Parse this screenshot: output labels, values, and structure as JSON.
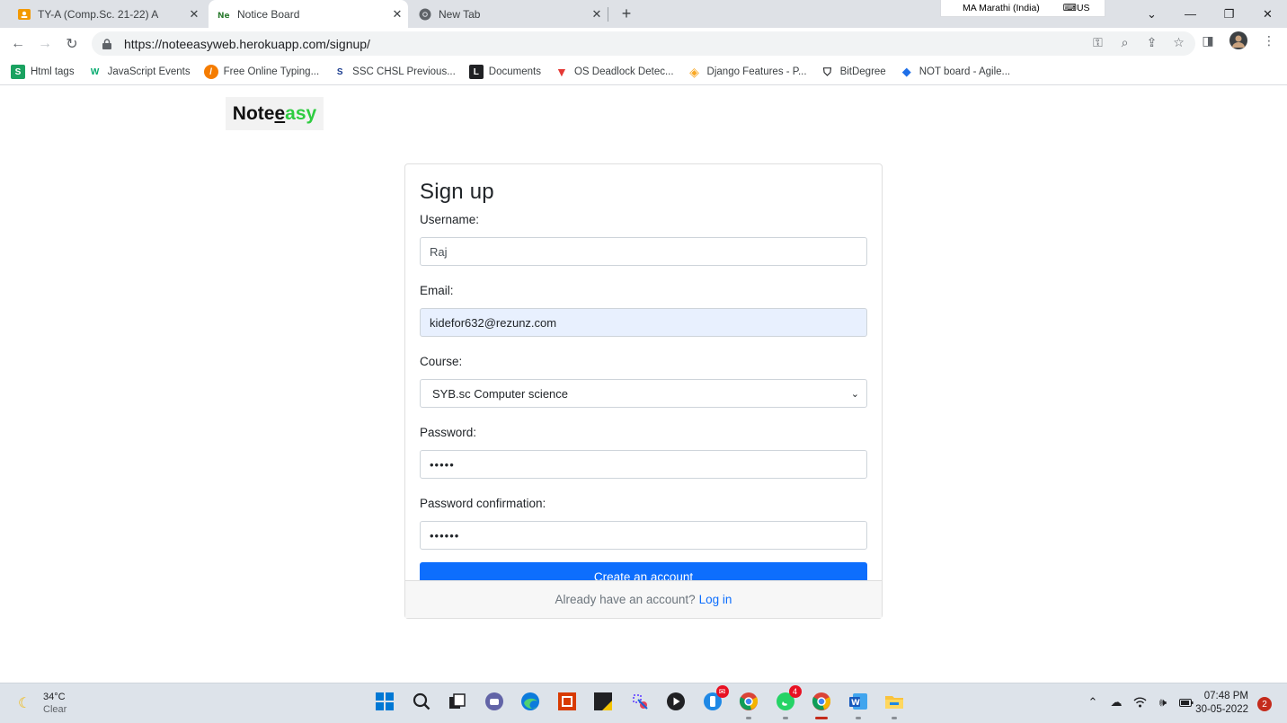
{
  "browser": {
    "tabs": [
      {
        "title": "TY-A (Comp.Sc. 21-22) A",
        "icon": "classroom-icon",
        "active": false
      },
      {
        "title": "Notice Board",
        "icon": "noteasy-icon",
        "active": true
      },
      {
        "title": "New Tab",
        "icon": "chrome-icon",
        "active": false
      }
    ],
    "ime_language": "MA Marathi (India)",
    "ime_layout": "US",
    "url": "https://noteeasyweb.herokuapp.com/signup/",
    "bookmarks": [
      {
        "label": "Html tags",
        "icon": "s-icon",
        "color": "#1aa260"
      },
      {
        "label": "JavaScript Events",
        "icon": "w3-icon",
        "color": "#04aa6d"
      },
      {
        "label": "Free Online Typing...",
        "icon": "typing-icon",
        "color": "#f57c00"
      },
      {
        "label": "SSC CHSL Previous...",
        "icon": "ss-icon",
        "color": "#1a3c8f"
      },
      {
        "label": "Documents",
        "icon": "documents-icon",
        "color": "#202124"
      },
      {
        "label": "OS Deadlock Detec...",
        "icon": "deadlock-icon",
        "color": "#e53935"
      },
      {
        "label": "Django Features - P...",
        "icon": "django-icon",
        "color": "#f9a825"
      },
      {
        "label": "BitDegree",
        "icon": "bitdegree-icon",
        "color": "#202124"
      },
      {
        "label": "NOT board - Agile...",
        "icon": "agile-icon",
        "color": "#1e6fe8"
      }
    ]
  },
  "page": {
    "logo": {
      "part1": "Note",
      "part2": "asy",
      "underlined": "e"
    },
    "form": {
      "title": "Sign up",
      "username_label": "Username:",
      "username_value": "Raj",
      "email_label": "Email:",
      "email_value": "kidefor632@rezunz.com",
      "course_label": "Course:",
      "course_value": "SYB.sc Computer science",
      "password_label": "Password:",
      "password_value": "•••••",
      "password_confirm_label": "Password confirmation:",
      "password_confirm_value": "••••••",
      "submit_label": "Create an account",
      "footer_text": "Already have an account?",
      "login_link": "Log in"
    },
    "accent_color": "#0d6efd"
  },
  "taskbar": {
    "weather_temp": "34°C",
    "weather_condition": "Clear",
    "whatsapp_badge": "4",
    "time": "07:48 PM",
    "date": "30-05-2022",
    "notification_count": "2"
  }
}
